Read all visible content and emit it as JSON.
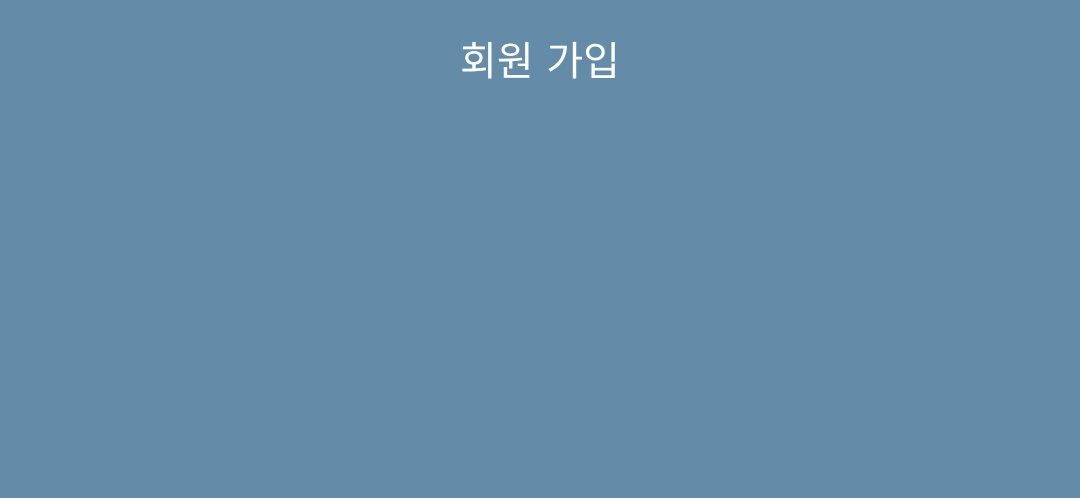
{
  "page": {
    "title": "회원 가입",
    "background_color": "#648ca8",
    "title_color": "#ffffff"
  }
}
